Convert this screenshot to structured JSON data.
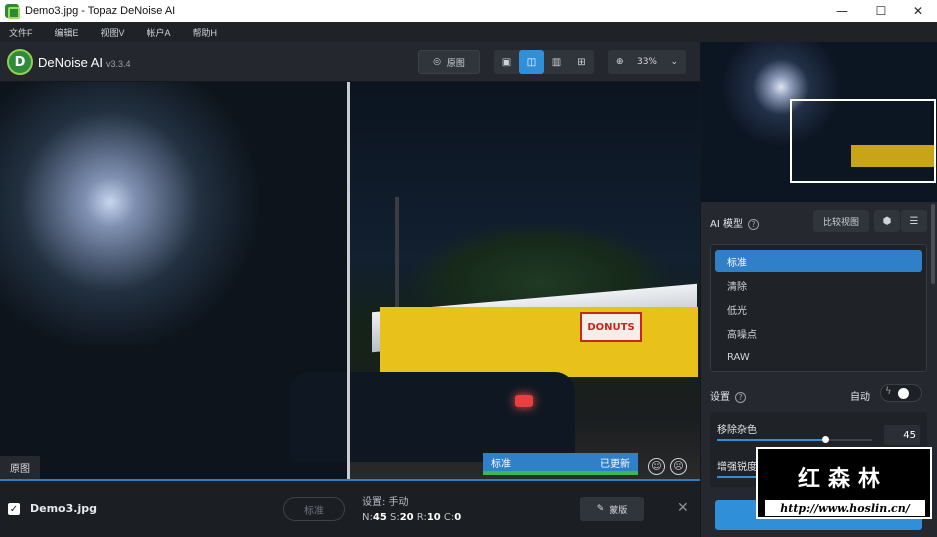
{
  "window": {
    "title": "Demo3.jpg - Topaz DeNoise AI",
    "minimize": "—",
    "maximize": "☐",
    "close": "✕"
  },
  "menu": [
    "文件F",
    "编辑E",
    "视图V",
    "帐户A",
    "帮助H"
  ],
  "app": {
    "logo_letter": "D",
    "name": "DeNoise AI",
    "version": "v3.3.4"
  },
  "toolbar": {
    "original_label": "原图",
    "zoom": "33%"
  },
  "preview": {
    "left_label": "原图",
    "status_model": "标准",
    "status_state": "已更新",
    "donut_sign": "DONUTS"
  },
  "bottom": {
    "filename": "Demo3.jpg",
    "model_pill": "标准",
    "settings_line1": "设置: 手动",
    "n_label": "N:",
    "n_val": "45",
    "s_label": "S:",
    "s_val": "20",
    "r_label": "R:",
    "r_val": "10",
    "c_label": "C:",
    "c_val": "0",
    "mask_label": "蒙版"
  },
  "sidebar": {
    "ai_model_title": "AI 模型",
    "compare_button": "比较视图",
    "models": [
      "标准",
      "清除",
      "低光",
      "高噪点",
      "RAW"
    ],
    "selected_model": 0,
    "settings_title": "设置",
    "auto_label": "自动",
    "sliders": [
      {
        "label": "移除杂色",
        "value": "45",
        "fraction": 0.45
      },
      {
        "label": "增强锐度",
        "value": "20",
        "fraction": 0.2
      }
    ]
  },
  "watermark": {
    "title": "红森林",
    "url": "http://www.hoslin.cn/"
  },
  "colors": {
    "accent": "#2f8fd9",
    "selected": "#2f7fc9",
    "updated_bar": "#39b85a"
  }
}
